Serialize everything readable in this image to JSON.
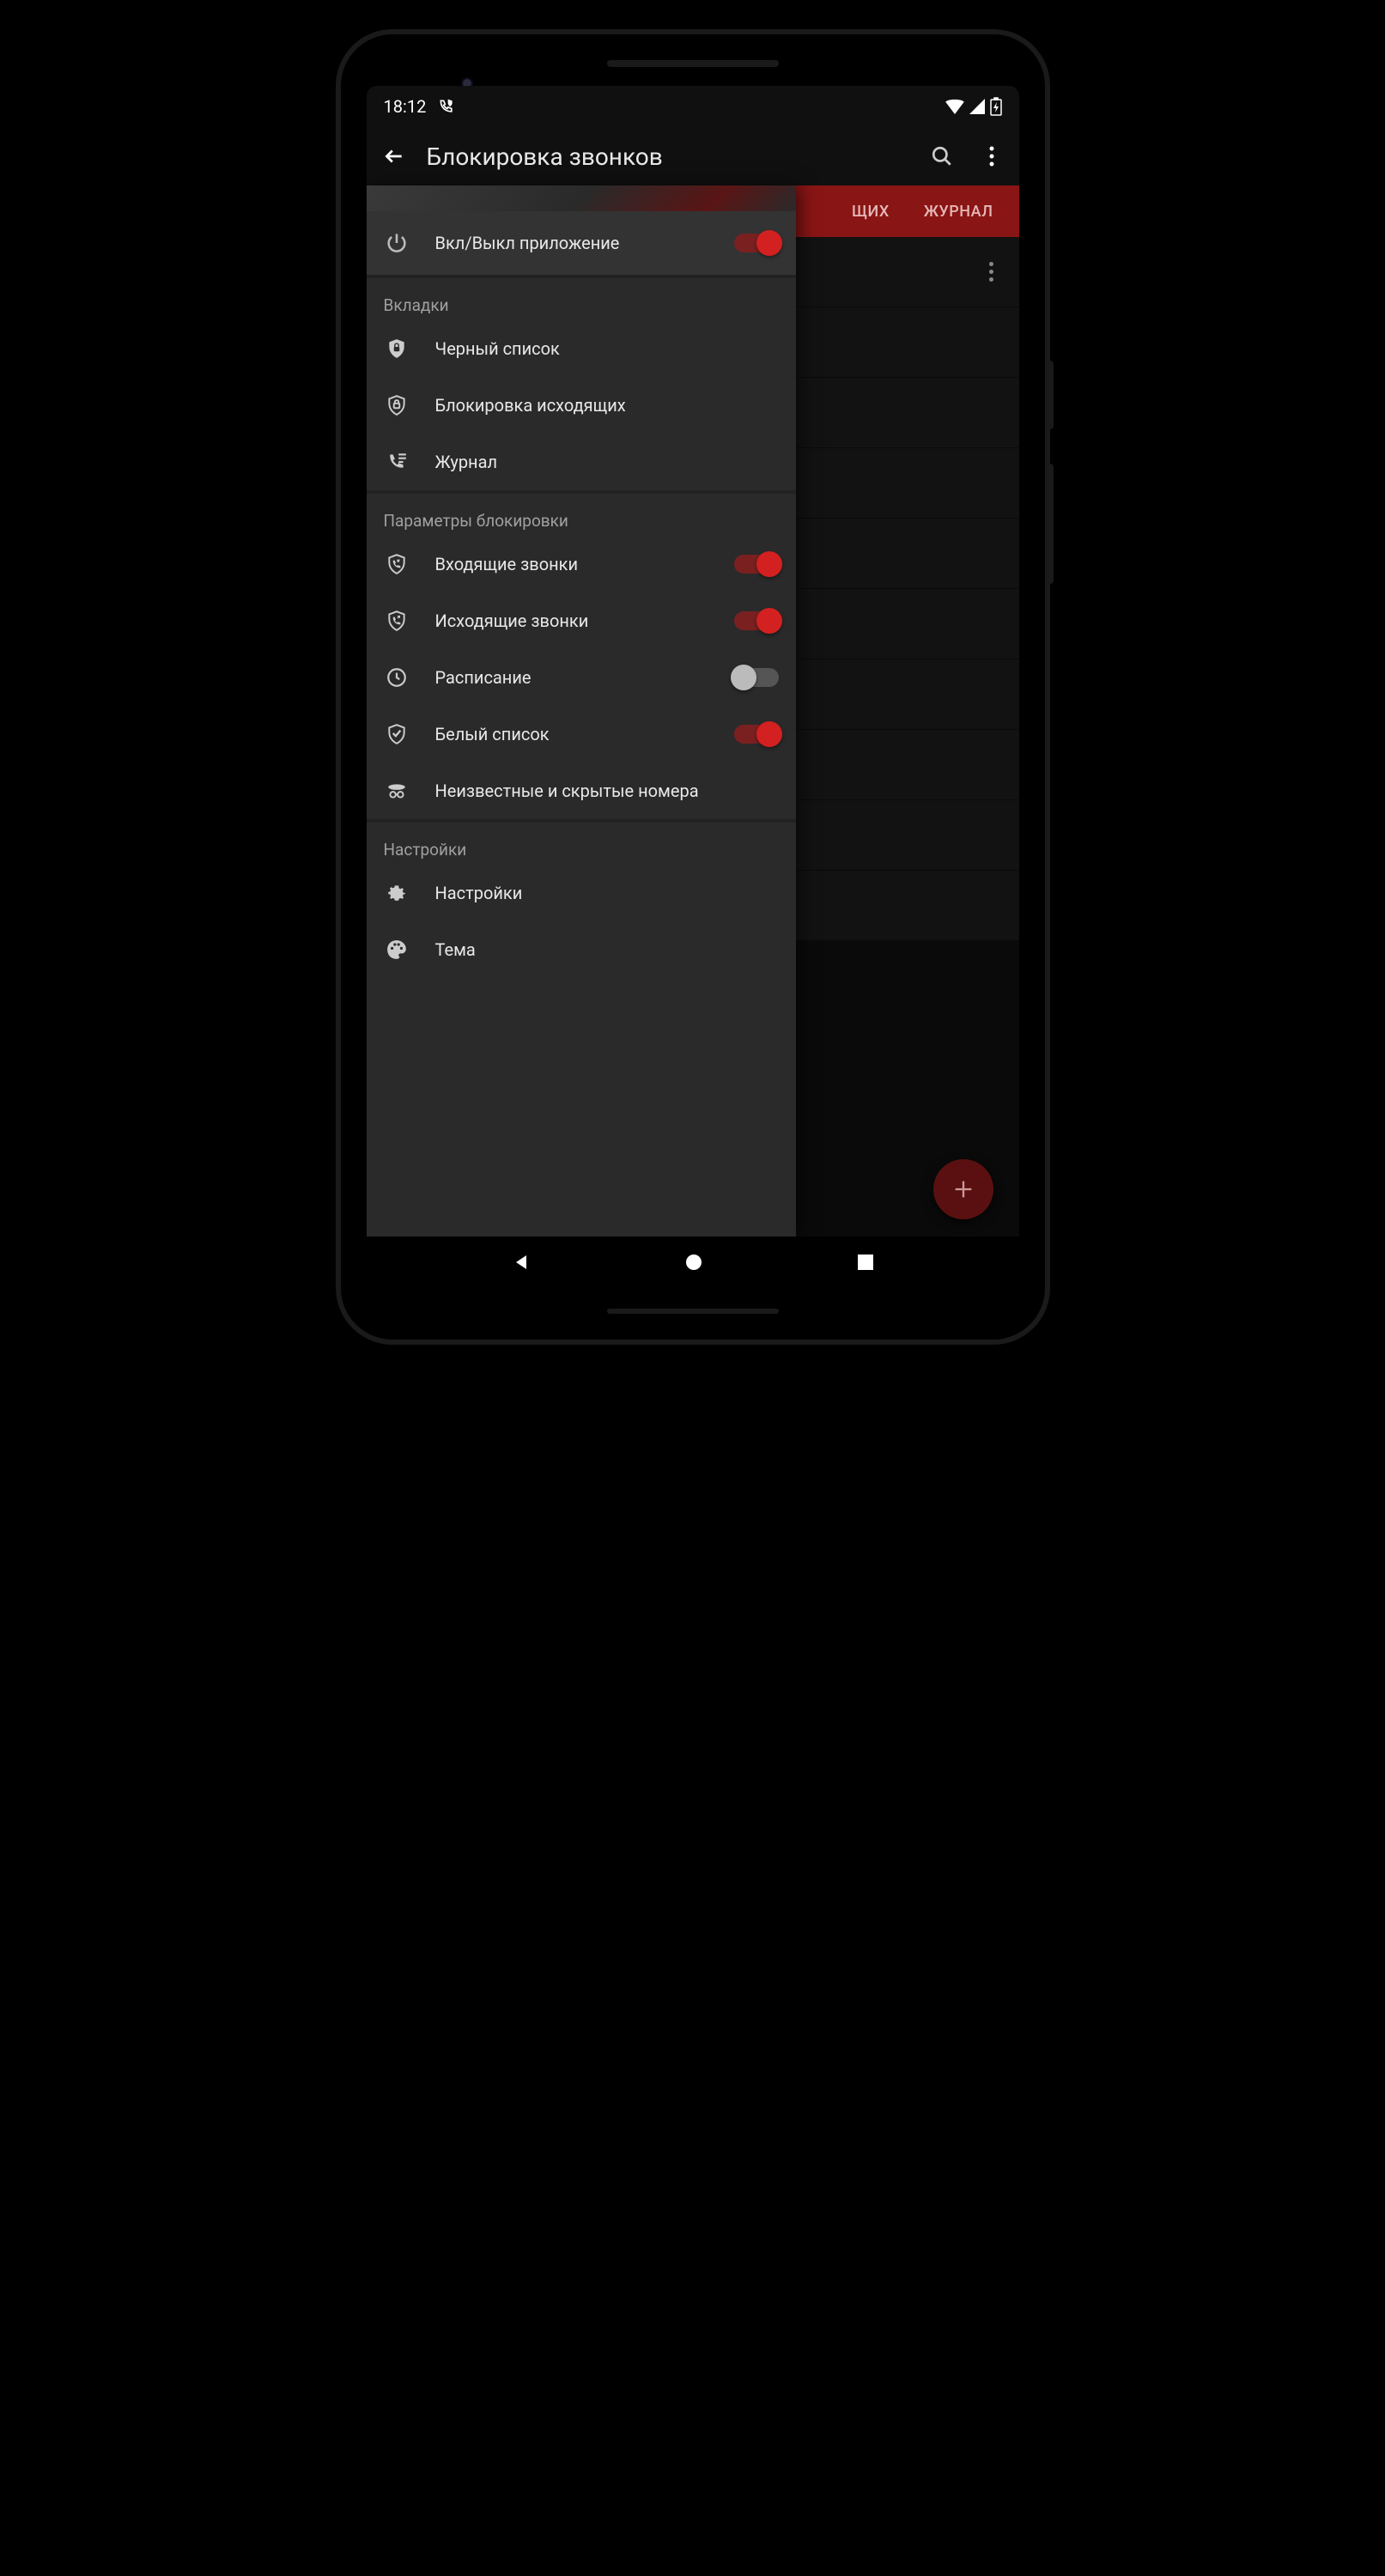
{
  "status": {
    "time": "18:12"
  },
  "appbar": {
    "title": "Блокировка звонков"
  },
  "tabs": {
    "partial": "ЩИХ",
    "log": "ЖУРНАЛ"
  },
  "drawer": {
    "main_toggle": {
      "label": "Вкл/Выкл приложение",
      "on": true
    },
    "section_tabs": "Вкладки",
    "tabs": {
      "blacklist": "Черный список",
      "outgoing_block": "Блокировка исходящих",
      "log": "Журнал"
    },
    "section_block": "Параметры блокировки",
    "block": {
      "incoming": {
        "label": "Входящие звонки",
        "on": true
      },
      "outgoing": {
        "label": "Исходящие звонки",
        "on": true
      },
      "schedule": {
        "label": "Расписание",
        "on": false
      },
      "whitelist": {
        "label": "Белый список",
        "on": true
      },
      "unknown": {
        "label": "Неизвестные и скрытые номера"
      }
    },
    "section_settings": "Настройки",
    "settings": {
      "settings": "Настройки",
      "theme": "Тема"
    }
  }
}
